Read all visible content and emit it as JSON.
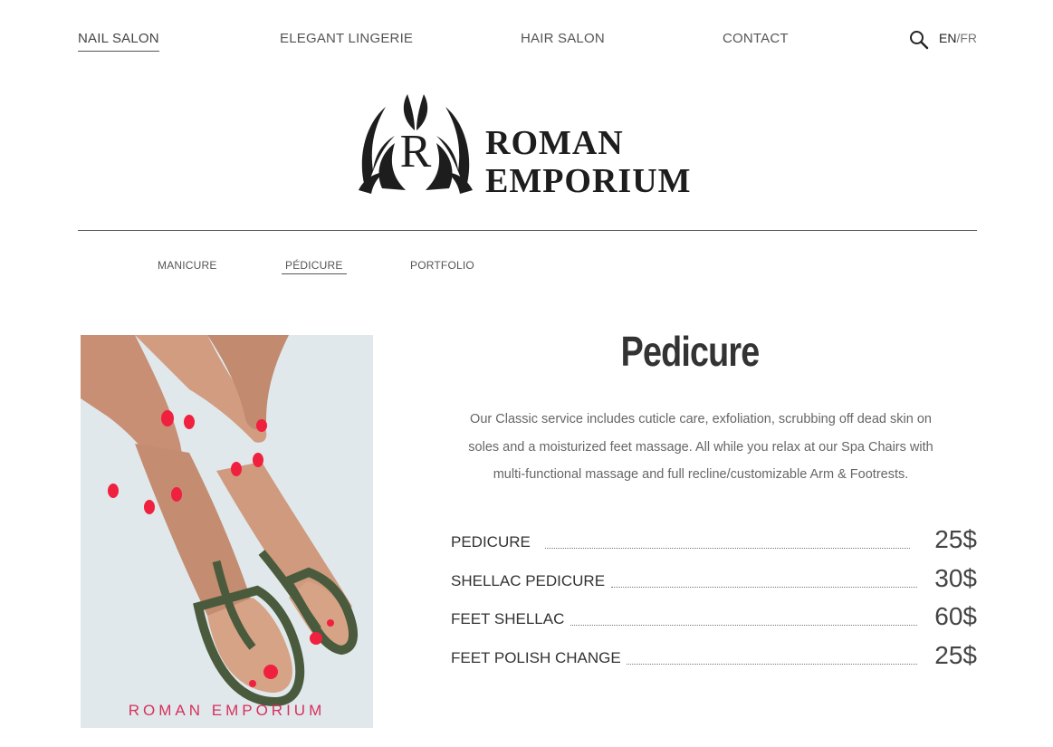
{
  "topnav": {
    "items": [
      "NAIL SALON",
      "ELEGANT LINGERIE",
      "HAIR SALON",
      "CONTACT"
    ],
    "active": "NAIL SALON"
  },
  "lang": {
    "en": "EN",
    "sep": "/",
    "fr": "FR"
  },
  "logo": {
    "monogram": "R",
    "line1": "ROMAN",
    "line2": "EMPORIUM"
  },
  "subnav": {
    "items": [
      "MANICURE",
      "PÉDICURE",
      "PORTFOLIO"
    ],
    "active": "PÉDICURE"
  },
  "image": {
    "brand_text": "ROMAN EMPORIUM"
  },
  "main": {
    "title": "Pedicure",
    "description_lines": [
      "Our Classic service includes cuticle care, exfoliation, scrubbing off dead skin on",
      "soles and a moisturized feet massage. All while you relax at our Spa Chairs with",
      "multi-functional massage and full recline/customizable Arm & Footrests."
    ]
  },
  "prices": [
    {
      "name": "PEDICURE",
      "price": "25$"
    },
    {
      "name": "SHELLAC PEDICURE",
      "price": "30$"
    },
    {
      "name": "FEET SHELLAC",
      "price": "60$"
    },
    {
      "name": "FEET POLISH CHANGE",
      "price": "25$"
    }
  ],
  "colors": {
    "brand_pink": "#d8305b",
    "nail_red": "#f0203f",
    "sandal_green": "#4a5a3c",
    "photo_bg": "#e0e8ec"
  },
  "icons": {
    "search": "search-icon"
  }
}
